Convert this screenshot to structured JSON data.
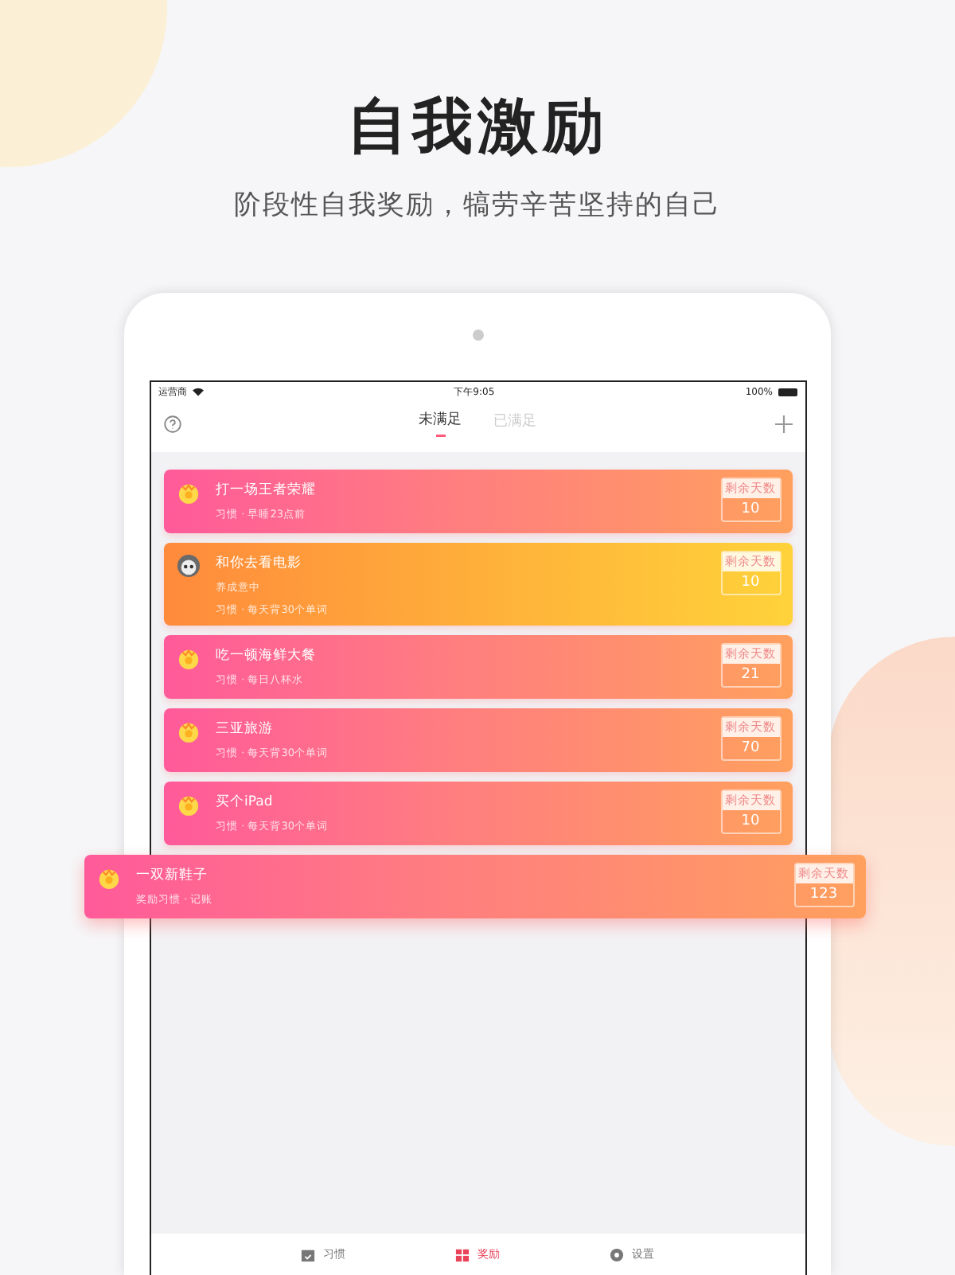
{
  "headline": "自我激励",
  "tagline": "阶段性自我奖励，犒劳辛苦坚持的自己",
  "status_bar": {
    "carrier": "运营商",
    "time": "下午9:05",
    "battery": "100%"
  },
  "tabs": [
    {
      "label": "未满足",
      "selected": true
    },
    {
      "label": "已满足",
      "selected": false
    }
  ],
  "rewards": [
    {
      "title": "打一场王者荣耀",
      "subtitle": "习惯 · 早睡23点前",
      "badge": "剩余天数",
      "days": "10",
      "kind": "pink",
      "dragging": false
    },
    {
      "title": "和你去看电影",
      "note": "养成意中",
      "subtitle": "习惯 · 每天背30个单词",
      "badge": "剩余天数",
      "days": "10",
      "kind": "orange",
      "dragging": false
    },
    {
      "title": "吃一顿海鲜大餐",
      "subtitle": "习惯 · 每日八杯水",
      "badge": "剩余天数",
      "days": "21",
      "kind": "pink",
      "dragging": false
    },
    {
      "title": "三亚旅游",
      "subtitle": "习惯 · 每天背30个单词",
      "badge": "剩余天数",
      "days": "70",
      "kind": "pink",
      "dragging": false
    },
    {
      "title": "买个iPad",
      "subtitle": "习惯 · 每天背30个单词",
      "badge": "剩余天数",
      "days": "10",
      "kind": "pink",
      "dragging": false
    },
    {
      "title": "一双新鞋子",
      "subtitle": "奖励习惯 · 记账",
      "badge": "剩余天数",
      "days": "123",
      "kind": "pink",
      "dragging": true
    }
  ],
  "tab_bar": [
    {
      "label": "习惯",
      "selected": false
    },
    {
      "label": "奖励",
      "selected": true
    },
    {
      "label": "设置",
      "selected": false
    }
  ]
}
